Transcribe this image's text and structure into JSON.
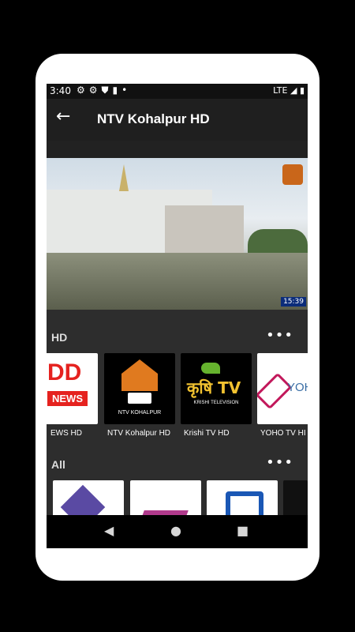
{
  "status_bar": {
    "time": "3:40",
    "icons": [
      "gear-icon",
      "gear-icon",
      "shield-icon",
      "sd-card-icon",
      "dot-icon"
    ],
    "network": "LTE",
    "battery_icon": "battery-icon"
  },
  "app_bar": {
    "back_icon": "arrow-left-icon",
    "title": "NTV Kohalpur HD"
  },
  "player": {
    "clock": "15:39"
  },
  "sections": [
    {
      "label": "HD",
      "more_icon": "more-horizontal-icon",
      "channels": [
        {
          "label": "EWS HD",
          "logo_text": "DD NEWS",
          "bg": "#ffffff"
        },
        {
          "label": "NTV Kohalpur HD",
          "logo_text": "NTV KOHALPUR",
          "bg": "#000000"
        },
        {
          "label": "Krishi TV HD",
          "logo_text": "कृषि TV",
          "logo_sub": "KRISHI TELEVISION",
          "bg": "#000000"
        },
        {
          "label": "YOHO TV HI",
          "logo_text": "YOHO",
          "bg": "#ffffff"
        }
      ]
    },
    {
      "label": "All",
      "more_icon": "more-horizontal-icon",
      "channels": [
        {
          "label": "",
          "bg": "#ffffff"
        },
        {
          "label": "",
          "bg": "#ffffff"
        },
        {
          "label": "",
          "bg": "#ffffff"
        },
        {
          "label": "",
          "bg": "#111111"
        }
      ]
    }
  ],
  "nav_bar": {
    "back": "◀",
    "home": "●",
    "recents": "■"
  },
  "colors": {
    "background": "#2d2d2d",
    "app_bar": "#1f1f1f",
    "status_bar": "#111111",
    "dd_red": "#e5221f",
    "krishi_green": "#66b32e",
    "ntv_orange": "#e07a1f"
  }
}
